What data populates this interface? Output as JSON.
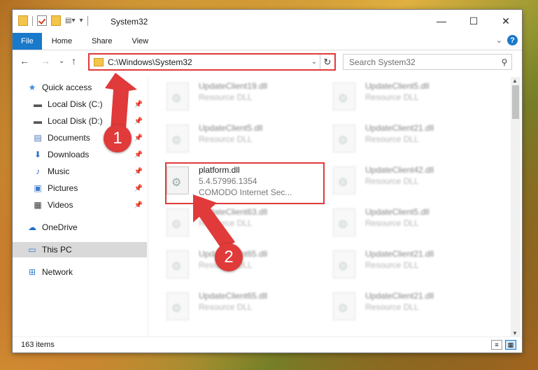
{
  "window": {
    "title": "System32",
    "controls": {
      "minimize": "—",
      "maximize": "☐",
      "close": "✕"
    }
  },
  "ribbon": {
    "tabs": [
      "File",
      "Home",
      "Share",
      "View"
    ],
    "help": "?"
  },
  "address": {
    "path": "C:\\Windows\\System32",
    "search_placeholder": "Search System32"
  },
  "nav": {
    "items": [
      {
        "label": "Quick access",
        "icon": "star-icon"
      },
      {
        "label": "Local Disk (C:)",
        "icon": "drive-icon"
      },
      {
        "label": "Local Disk (D:)",
        "icon": "drive-icon"
      },
      {
        "label": "Documents",
        "icon": "documents-icon"
      },
      {
        "label": "Downloads",
        "icon": "downloads-icon"
      },
      {
        "label": "Music",
        "icon": "music-icon"
      },
      {
        "label": "Pictures",
        "icon": "pictures-icon"
      },
      {
        "label": "Videos",
        "icon": "videos-icon"
      },
      {
        "label": "OneDrive",
        "icon": "cloud-icon"
      },
      {
        "label": "This PC",
        "icon": "computer-icon"
      },
      {
        "label": "Network",
        "icon": "network-icon"
      }
    ]
  },
  "files": [
    {
      "name": "UpdateClient19.dll",
      "desc": "Resource DLL"
    },
    {
      "name": "UpdateClient5.dll",
      "desc": "Resource DLL"
    },
    {
      "name": "UpdateClient5.dll",
      "desc": "Resource DLL"
    },
    {
      "name": "UpdateClient21.dll",
      "desc": "Resource DLL"
    },
    {
      "name": "platform.dll",
      "desc": "5.4.57996.1354",
      "desc2": "COMODO Internet Sec..."
    },
    {
      "name": "UpdateClient42.dll",
      "desc": "Resource DLL"
    },
    {
      "name": "UpdateClient63.dll",
      "desc": "Resource DLL"
    },
    {
      "name": "UpdateClient5.dll",
      "desc": "Resource DLL"
    },
    {
      "name": "UpdateClient65.dll",
      "desc": "Resource DLL"
    },
    {
      "name": "UpdateClient21.dll",
      "desc": "Resource DLL"
    },
    {
      "name": "UpdateClient65.dll",
      "desc": "Resource DLL"
    },
    {
      "name": "UpdateClient21.dll",
      "desc": "Resource DLL"
    }
  ],
  "status": {
    "count": "163 items"
  },
  "annotations": {
    "step1": "1",
    "step2": "2",
    "color": "#e03a3a"
  }
}
